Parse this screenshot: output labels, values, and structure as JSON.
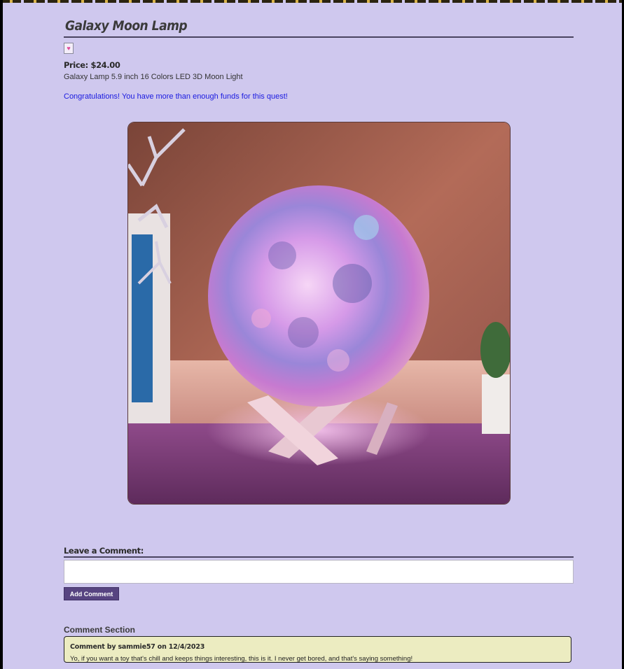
{
  "product": {
    "title": "Galaxy Moon Lamp",
    "favorite_icon": "heart-icon",
    "price": "Price: $24.00",
    "description": "Galaxy Lamp 5.9 inch 16 Colors LED 3D Moon Light",
    "funds_message": "Congratulations! You have more than enough funds for this quest!"
  },
  "comment_form": {
    "heading": "Leave a Comment:",
    "input_value": "",
    "input_placeholder": "",
    "submit_label": "Add Comment"
  },
  "comments": {
    "section_title": "Comment Section",
    "items": [
      {
        "meta": "Comment by sammie57 on 12/4/2023",
        "text": "Yo, if you want a toy that's chill and keeps things interesting, this is it. I never get bored, and that's saying something!"
      }
    ]
  },
  "colors": {
    "page_background": "#cfc8ee",
    "button_background": "#574481",
    "comment_card_background": "#ececc1",
    "funds_message": "#1a1ae0"
  }
}
